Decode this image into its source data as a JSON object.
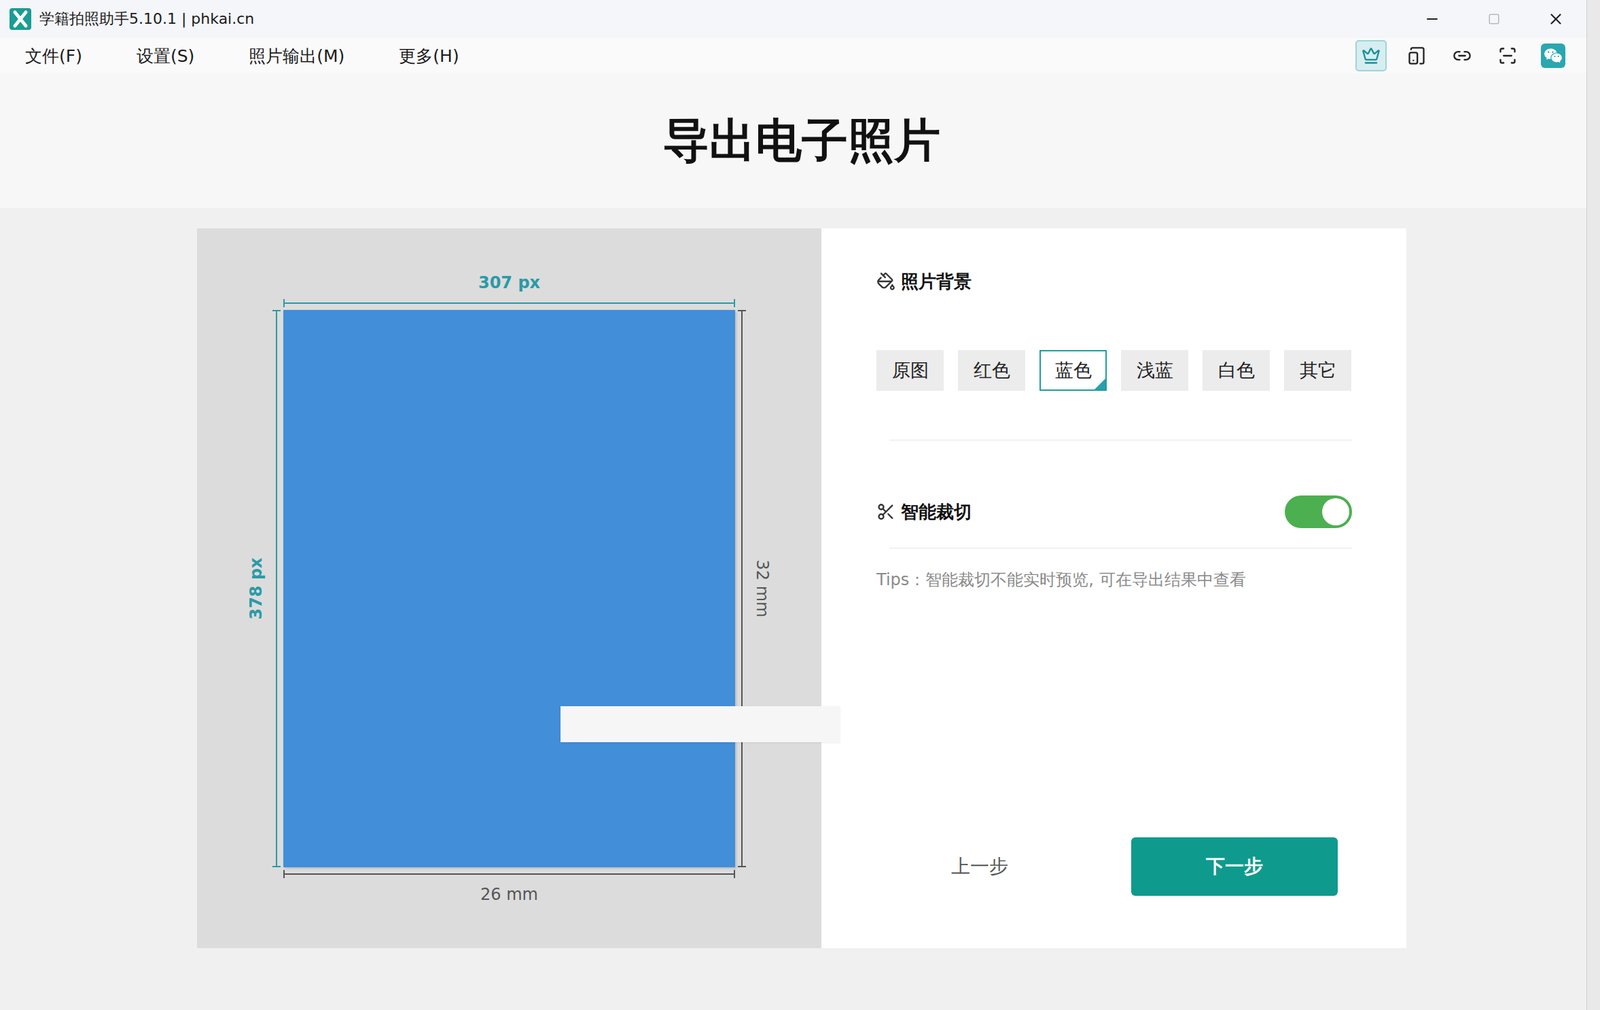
{
  "window": {
    "title": "学籍拍照助手5.10.1 | phkai.cn",
    "maximize_disabled": true
  },
  "menu": [
    "文件(F)",
    "设置(S)",
    "照片输出(M)",
    "更多(H)"
  ],
  "toolbar": [
    {
      "selected": true
    },
    {
      "selected": false
    },
    {
      "selected": false
    },
    {
      "selected": false
    },
    {
      "selected": false
    }
  ],
  "page_title": "导出电子照片",
  "preview": {
    "width_px": "307 px",
    "height_px": "378 px",
    "height_mm": "32 mm",
    "width_mm": "26 mm"
  },
  "background": {
    "label": "照片背景",
    "options": [
      {
        "label": "原图",
        "selected": false
      },
      {
        "label": "红色",
        "selected": false
      },
      {
        "label": "蓝色",
        "selected": true
      },
      {
        "label": "浅蓝",
        "selected": false
      },
      {
        "label": "白色",
        "selected": false
      },
      {
        "label": "其它",
        "selected": false
      }
    ]
  },
  "smart_crop": {
    "label": "智能裁切",
    "on": true,
    "tip": "Tips：智能裁切不能实时预览, 可在导出结果中查看"
  },
  "buttons": [
    {
      "label": "上一步",
      "kind": "link"
    },
    {
      "label": "下一步",
      "kind": "primary"
    }
  ]
}
